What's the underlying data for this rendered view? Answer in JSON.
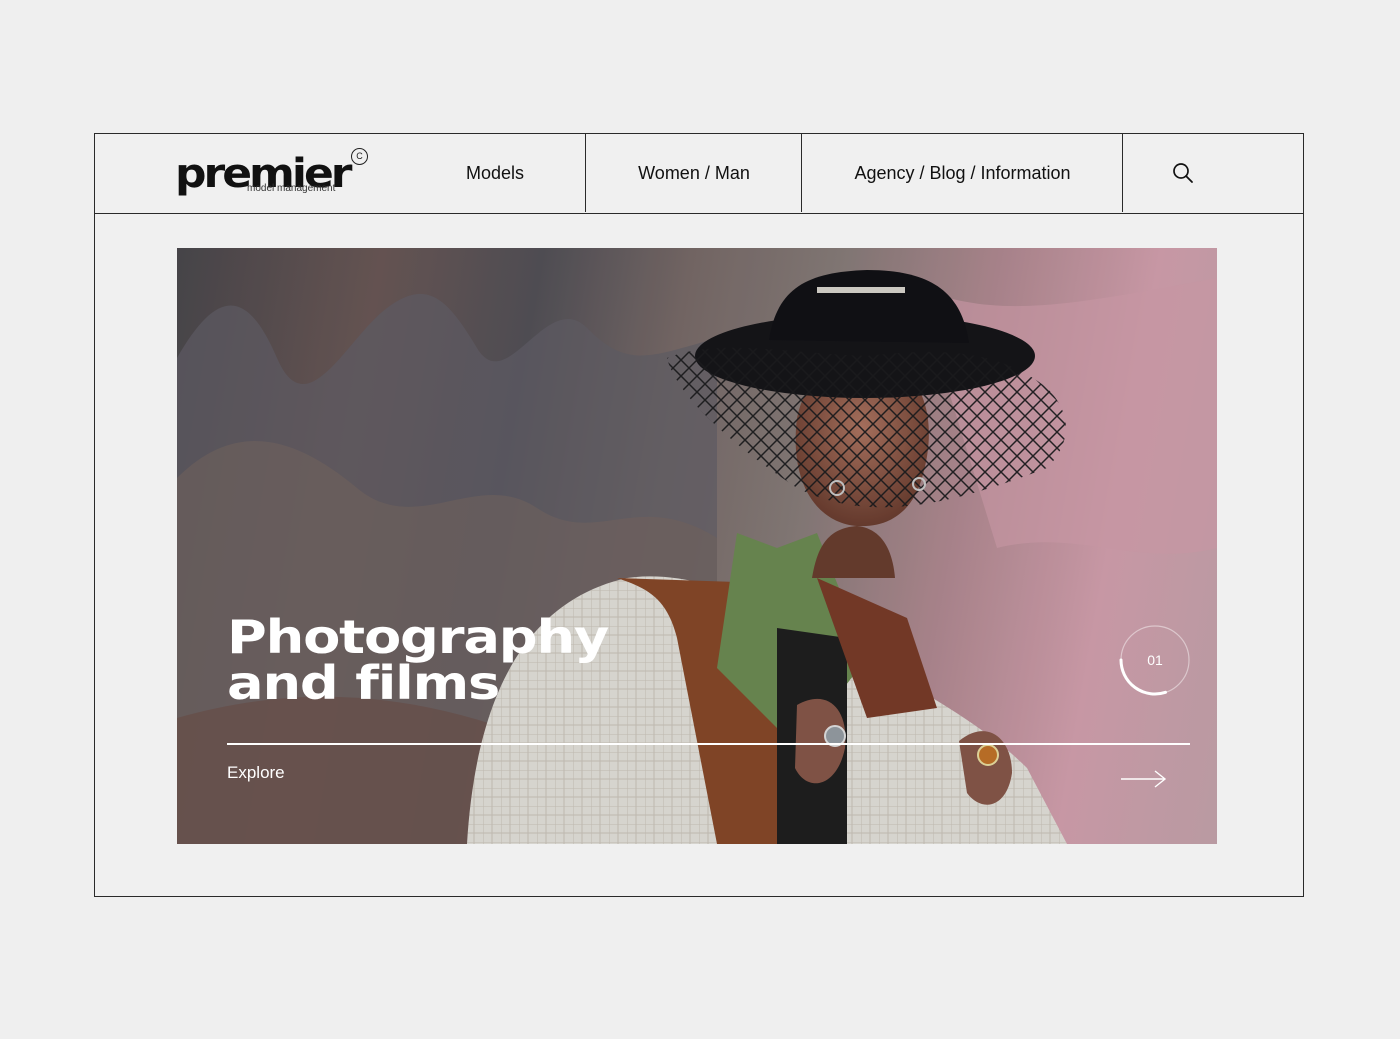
{
  "brand": {
    "name": "premier",
    "subtitle": "model management",
    "mark": "C"
  },
  "nav": {
    "items": [
      {
        "label": "Models"
      },
      {
        "label": "Women / Man"
      },
      {
        "label": "Agency / Blog / Information"
      }
    ],
    "search_icon": "search-icon"
  },
  "hero": {
    "title_line1": "Photography",
    "title_line2": "and films",
    "cta": "Explore",
    "slide_number": "01",
    "slide_progress": 0.3,
    "arrow_icon": "arrow-right-icon"
  },
  "colors": {
    "background": "#efefef",
    "border": "#2a2a2a",
    "text": "#111111",
    "hero_text": "#ffffff"
  }
}
